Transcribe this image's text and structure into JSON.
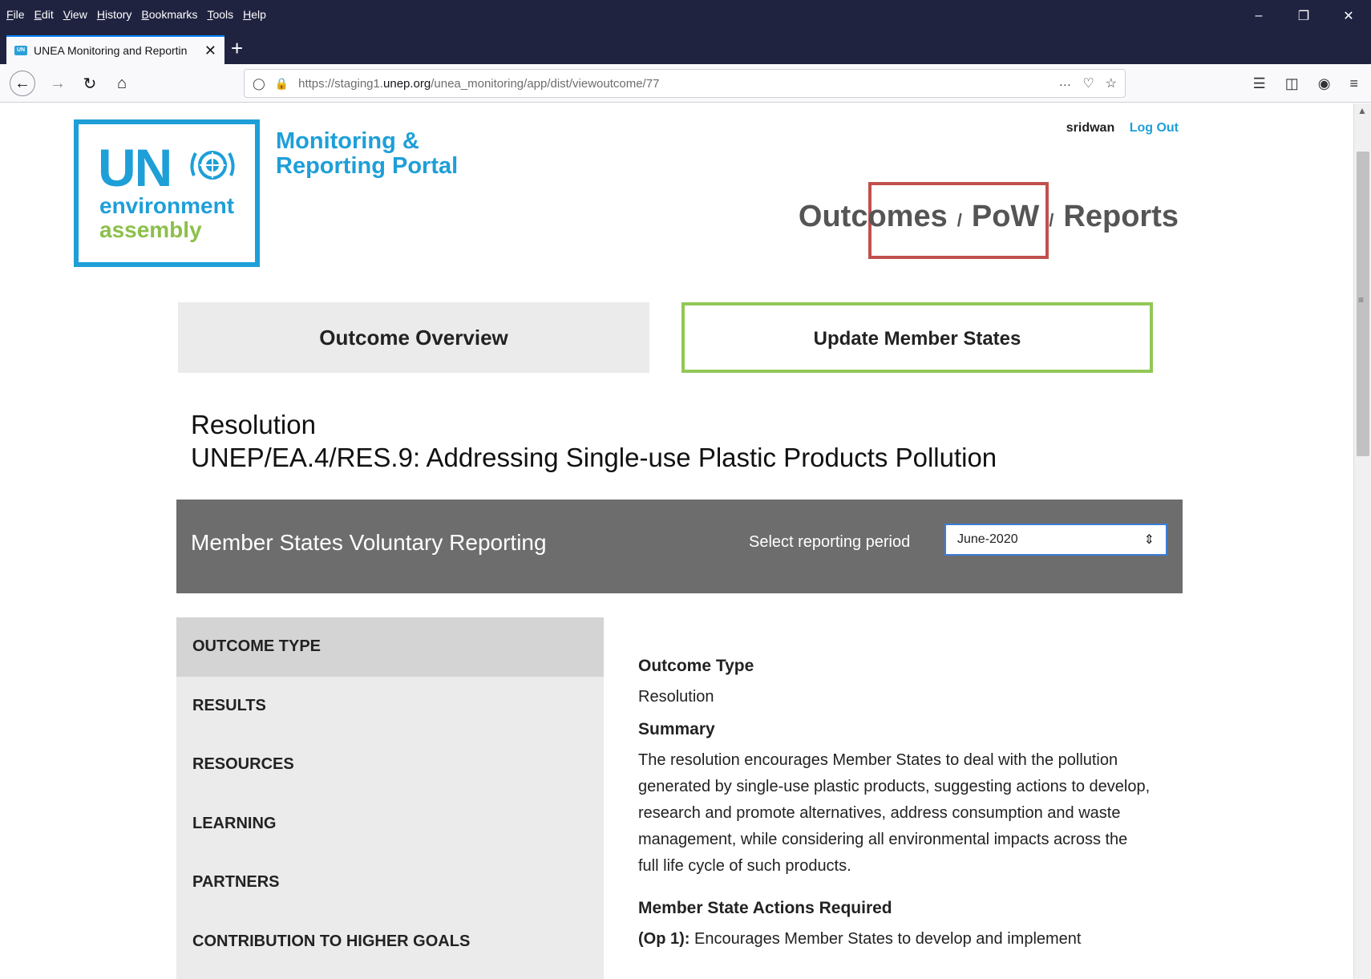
{
  "browser": {
    "menu": [
      "File",
      "Edit",
      "View",
      "History",
      "Bookmarks",
      "Tools",
      "Help"
    ],
    "tab_title": "UNEA Monitoring and Reportin",
    "url_prefix": "https://staging1.",
    "url_domain": "unep.org",
    "url_path": "/unea_monitoring/app/dist/viewoutcome/77"
  },
  "header": {
    "logo_un": "UN",
    "logo_environment": "environment",
    "logo_assembly": "assembly",
    "portal_line1": "Monitoring &",
    "portal_line2": "Reporting Portal",
    "username": "sridwan",
    "logout": "Log Out",
    "nav": {
      "outcomes": "Outcomes",
      "pow": "PoW",
      "reports": "Reports",
      "separator": "/"
    }
  },
  "tabs": {
    "overview": "Outcome Overview",
    "update": "Update Member States"
  },
  "resolution": {
    "line1": "Resolution",
    "line2": "UNEP/EA.4/RES.9: Addressing Single-use Plastic Products Pollution"
  },
  "banner": {
    "title": "Member States Voluntary Reporting",
    "period_label": "Select reporting period",
    "period_value": "June-2020"
  },
  "sidenav": {
    "items": [
      {
        "label": "OUTCOME TYPE"
      },
      {
        "label": "RESULTS"
      },
      {
        "label": "RESOURCES"
      },
      {
        "label": "LEARNING"
      },
      {
        "label": "PARTNERS"
      },
      {
        "label": "CONTRIBUTION TO HIGHER GOALS"
      }
    ]
  },
  "detail": {
    "type_heading": "Outcome Type",
    "type_value": "Resolution",
    "summary_heading": "Summary",
    "summary_text": "The resolution encourages Member States to deal with the pollution generated by single-use plastic products, suggesting actions to develop, research and promote alternatives, address consumption and waste management, while considering all environmental impacts across the full life cycle of such products.",
    "actions_heading": "Member State Actions Required",
    "op1_label": "(Op 1):",
    "op1_text": " Encourages Member States to develop and implement"
  },
  "colors": {
    "un_blue": "#1e9fd8",
    "assembly_green": "#8cc04a",
    "banner_gray": "#6d6d6d",
    "highlight_red": "#c0504d",
    "highlight_green": "#92c757"
  }
}
